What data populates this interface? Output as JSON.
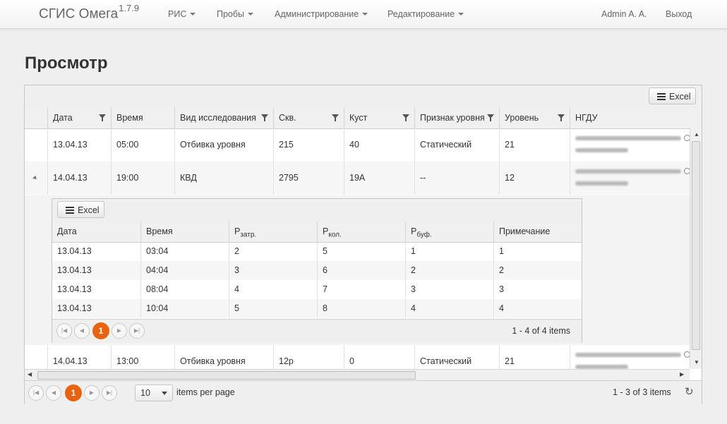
{
  "app": {
    "name": "СГИС Омега",
    "version": "1.7.9"
  },
  "nav": {
    "items": [
      "РИС",
      "Пробы",
      "Администрирование",
      "Редактирование"
    ],
    "user": "Admin A. A.",
    "logout": "Выход"
  },
  "page_title": "Просмотр",
  "grid": {
    "excel_label": "Excel",
    "columns": [
      "Дата",
      "Время",
      "Вид исследования",
      "Скв.",
      "Куст",
      "Признак уровня",
      "Уровень",
      "НГДУ"
    ],
    "rows": [
      {
        "date": "13.04.13",
        "time": "05:00",
        "type": "Отбивка уровня",
        "well": "215",
        "pad": "40",
        "sign": "Статический",
        "level": "21"
      },
      {
        "date": "14.04.13",
        "time": "19:00",
        "type": "КВД",
        "well": "2795",
        "pad": "19А",
        "sign": "--",
        "level": "12"
      },
      {
        "date": "14.04.13",
        "time": "13:00",
        "type": "Отбивка уровня",
        "well": "12р",
        "pad": "0",
        "sign": "Статический",
        "level": "21"
      }
    ],
    "pager": {
      "page": "1",
      "page_size": "10",
      "per_page_label": "items per page",
      "summary": "1 - 3 of 3 items"
    }
  },
  "detail": {
    "excel_label": "Excel",
    "columns": {
      "date": "Дата",
      "time": "Время",
      "p1": "P",
      "p1_sub": "затр.",
      "p2": "P",
      "p2_sub": "кол.",
      "p3": "P",
      "p3_sub": "буф.",
      "note": "Примечание"
    },
    "rows": [
      {
        "date": "13.04.13",
        "time": "03:04",
        "p1": "2",
        "p2": "5",
        "p3": "1",
        "note": "1"
      },
      {
        "date": "13.04.13",
        "time": "04:04",
        "p1": "3",
        "p2": "6",
        "p3": "2",
        "note": "2"
      },
      {
        "date": "13.04.13",
        "time": "08:04",
        "p1": "4",
        "p2": "7",
        "p3": "3",
        "note": "3"
      },
      {
        "date": "13.04.13",
        "time": "10:04",
        "p1": "5",
        "p2": "8",
        "p3": "4",
        "note": "4"
      }
    ],
    "pager": {
      "page": "1",
      "summary": "1 - 4 of 4 items"
    }
  },
  "colors": {
    "accent": "#e8620f"
  }
}
